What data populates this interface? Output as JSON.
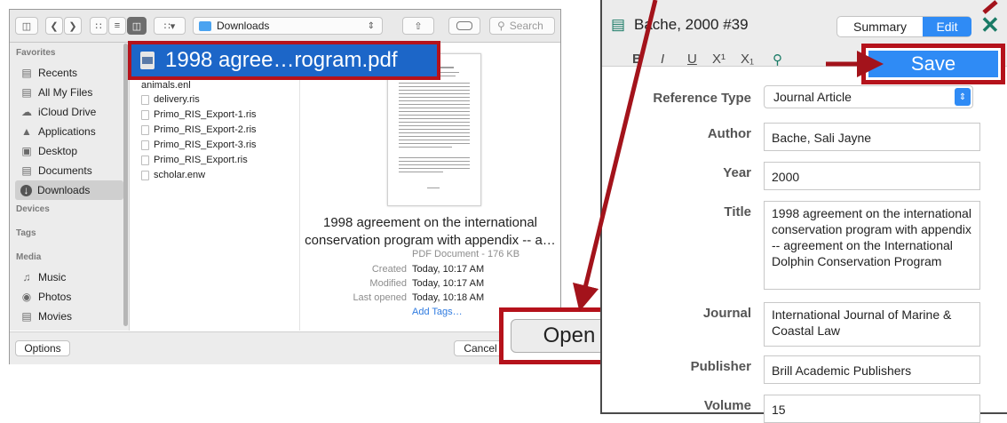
{
  "finder": {
    "path": "Downloads",
    "search_placeholder": "Search",
    "sidebar": {
      "favorites_heading": "Favorites",
      "favorites": [
        {
          "label": "Recents",
          "icon": "recents-icon"
        },
        {
          "label": "All My Files",
          "icon": "all-files-icon"
        },
        {
          "label": "iCloud Drive",
          "icon": "cloud-icon"
        },
        {
          "label": "Applications",
          "icon": "applications-icon"
        },
        {
          "label": "Desktop",
          "icon": "desktop-icon"
        },
        {
          "label": "Documents",
          "icon": "documents-icon"
        },
        {
          "label": "Downloads",
          "icon": "downloads-icon",
          "selected": true
        }
      ],
      "devices_heading": "Devices",
      "tags_heading": "Tags",
      "media_heading": "Media",
      "media": [
        {
          "label": "Music",
          "icon": "music-icon"
        },
        {
          "label": "Photos",
          "icon": "photos-icon"
        },
        {
          "label": "Movies",
          "icon": "movies-icon"
        }
      ]
    },
    "files": [
      "animals.enl",
      "delivery.ris",
      "Primo_RIS_Export-1.ris",
      "Primo_RIS_Export-2.ris",
      "Primo_RIS_Export-3.ris",
      "Primo_RIS_Export.ris",
      "scholar.enw"
    ],
    "selected_file": "1998 agree…rogram.pdf",
    "preview": {
      "name": "1998 agreement on the international conservation program with appendix -- a…",
      "kind": "PDF Document - 176 KB",
      "created_label": "Created",
      "created": "Today, 10:17 AM",
      "modified_label": "Modified",
      "modified": "Today, 10:17 AM",
      "last_opened_label": "Last opened",
      "last_opened": "Today, 10:18 AM",
      "add_tags": "Add Tags…"
    },
    "options_label": "Options",
    "cancel_label": "Cancel",
    "open_label": "Open"
  },
  "endnote": {
    "title": "Bache, 2000 #39",
    "tab_summary": "Summary",
    "tab_edit": "Edit",
    "format": {
      "bold": "B",
      "italic": "I",
      "underline": "U",
      "superscript": "X¹",
      "subscript": "X₁"
    },
    "save_label": "Save",
    "fields": {
      "reference_type_label": "Reference Type",
      "reference_type": "Journal Article",
      "author_label": "Author",
      "author": "Bache, Sali Jayne",
      "year_label": "Year",
      "year": "2000",
      "title_label": "Title",
      "title": "1998 agreement on the international conservation program with appendix -- agreement on the International Dolphin Conservation Program",
      "journal_label": "Journal",
      "journal": "International Journal of Marine & Coastal Law",
      "publisher_label": "Publisher",
      "publisher": "Brill Academic Publishers",
      "volume_label": "Volume",
      "volume": "15"
    }
  },
  "colors": {
    "highlight_red": "#b5121b",
    "accent_blue": "#2f8bf5",
    "selection_blue": "#1c66c8",
    "arrow_red": "#a3131b"
  }
}
